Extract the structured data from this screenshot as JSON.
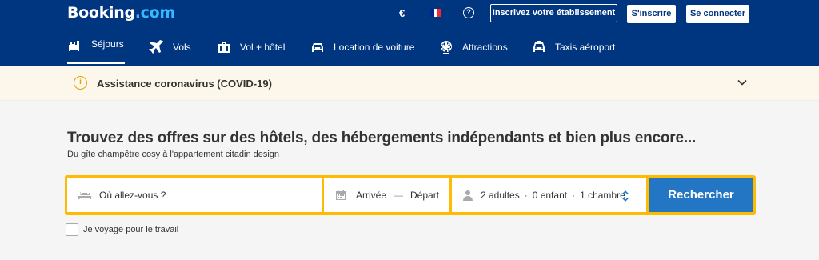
{
  "header": {
    "logo_main": "Booking",
    "logo_suffix": ".com",
    "currency": "€",
    "flag_colors": [
      "#002395",
      "#ffffff",
      "#ed2939"
    ],
    "help_icon": "?",
    "list_property_label": "Inscrivez votre établissement",
    "signup_label": "S'inscrire",
    "login_label": "Se connecter"
  },
  "nav": {
    "items": [
      {
        "label": "Séjours",
        "icon": "bed-icon",
        "active": true
      },
      {
        "label": "Vols",
        "icon": "plane-icon"
      },
      {
        "label": "Vol + hôtel",
        "icon": "suitcase-icon"
      },
      {
        "label": "Location de voiture",
        "icon": "car-icon"
      },
      {
        "label": "Attractions",
        "icon": "ferris-wheel-icon"
      },
      {
        "label": "Taxis aéroport",
        "icon": "taxi-icon"
      }
    ]
  },
  "covid_banner": {
    "icon": "i",
    "text": "Assistance coronavirus (COVID-19)"
  },
  "hero": {
    "title": "Trouvez des offres sur des hôtels, des hébergements indépendants et bien plus encore...",
    "subtitle": "Du gîte champêtre cosy à l'appartement citadin design"
  },
  "search": {
    "destination_placeholder": "Où allez-vous ?",
    "checkin_label": "Arrivée",
    "dates_separator": "—",
    "checkout_label": "Départ",
    "adults": "2 adultes",
    "children": "0 enfant",
    "rooms": "1 chambre",
    "guest_separator": "·",
    "submit_label": "Rechercher"
  },
  "work_trip": {
    "label": "Je voyage pour le travail",
    "checked": false
  },
  "colors": {
    "brand_blue": "#003580",
    "accent_light_blue": "#35b8ff",
    "search_border": "#febb02",
    "button_blue": "#2376c4",
    "banner_bg": "#fcf7ea",
    "warning_icon": "#e0a400"
  }
}
